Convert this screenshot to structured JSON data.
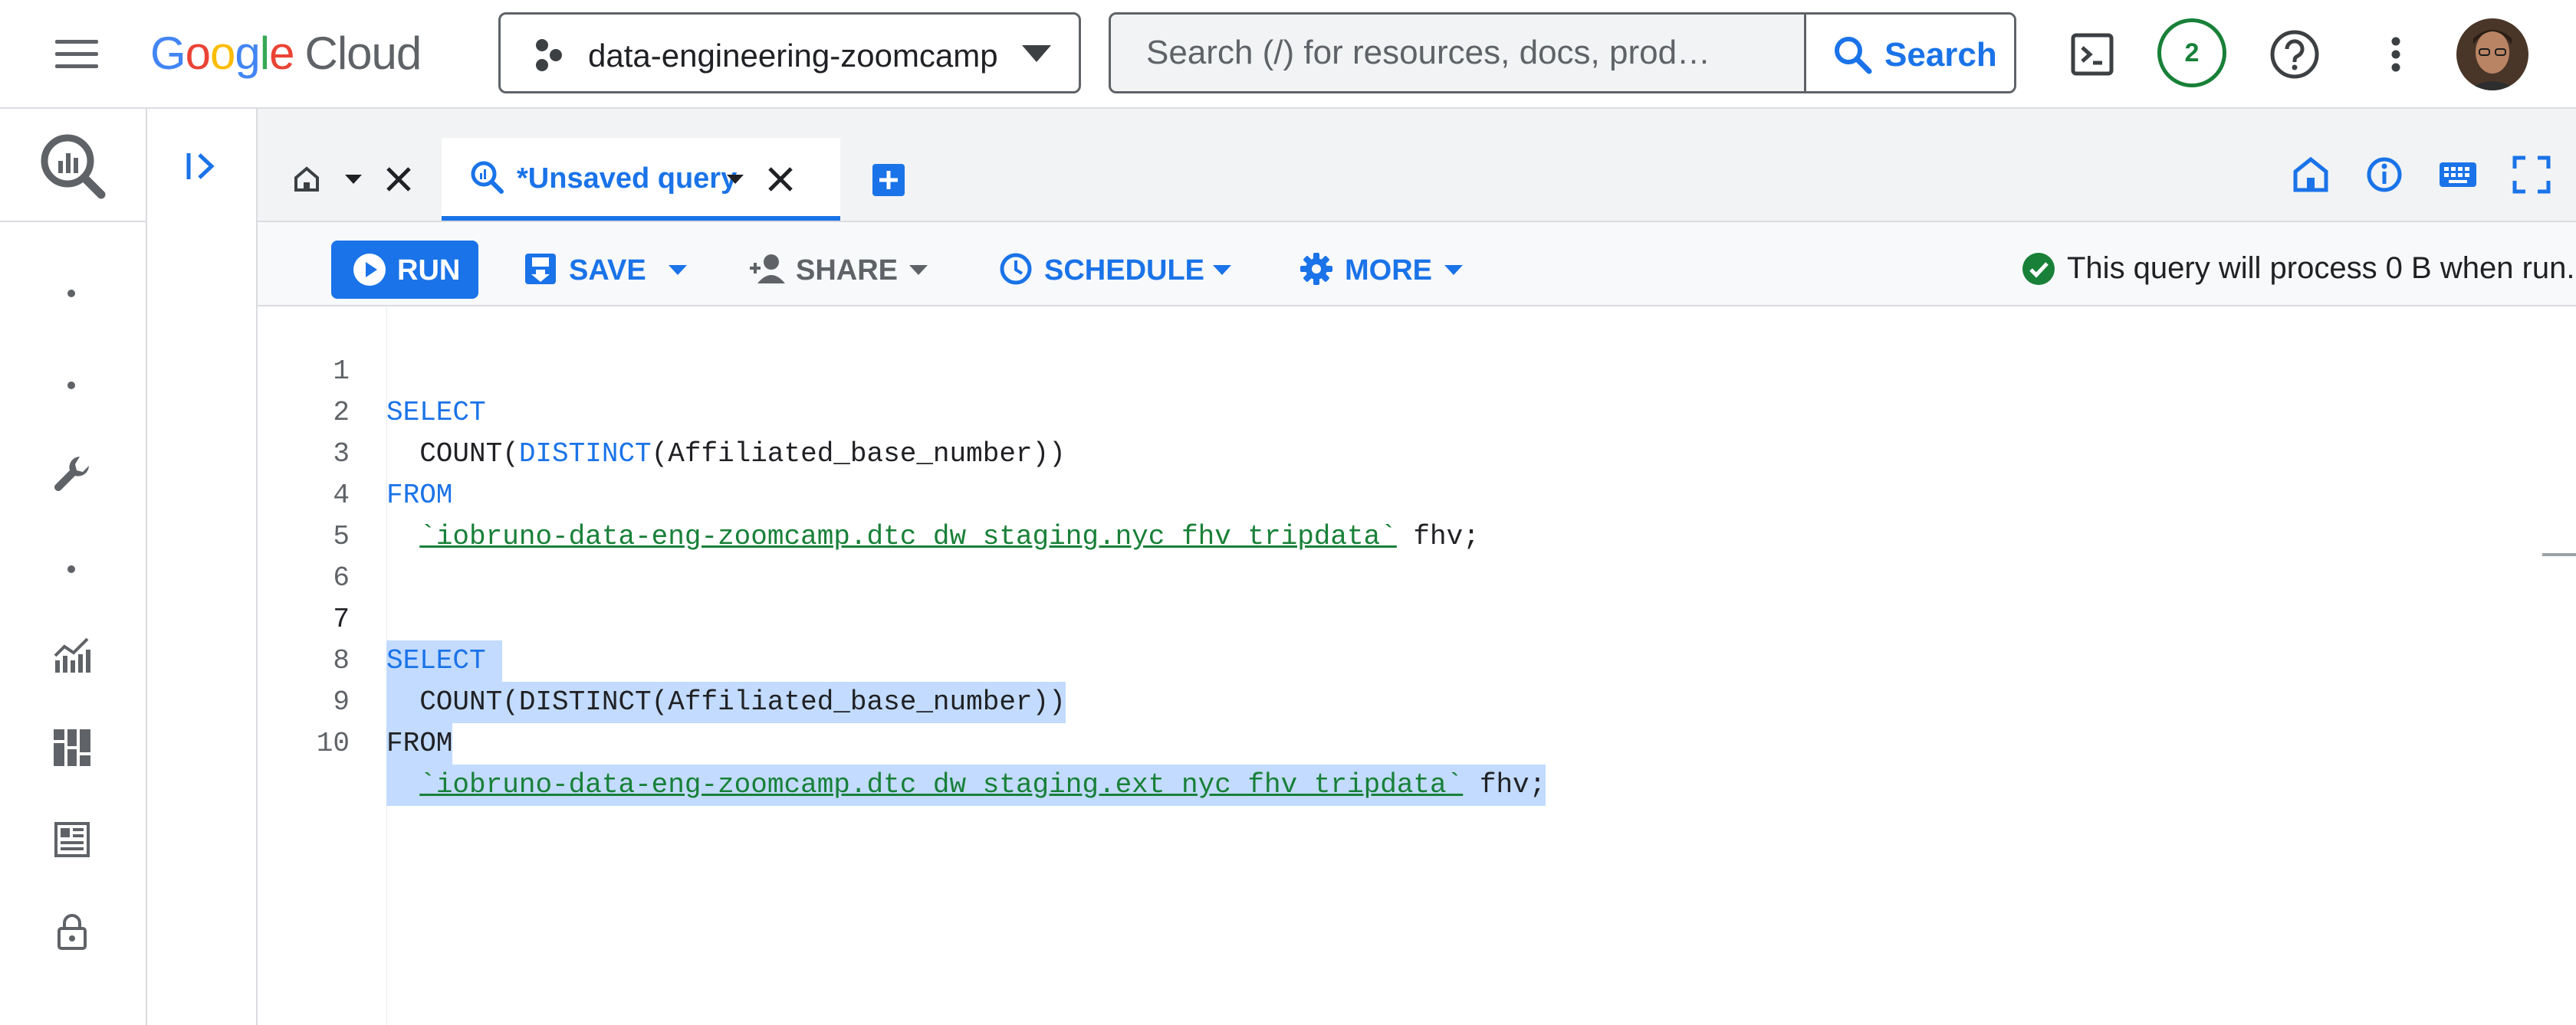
{
  "header": {
    "logo": {
      "google": "Google",
      "cloud": "Cloud"
    },
    "project": "data-engineering-zoomcamp",
    "search_placeholder": "Search (/) for resources, docs, prod…",
    "search_button": "Search",
    "notification_count": "2"
  },
  "tabs": [
    {
      "label": "*Unsaved query",
      "active": true
    }
  ],
  "toolbar": {
    "run": "RUN",
    "save": "SAVE",
    "share": "SHARE",
    "schedule": "SCHEDULE",
    "more": "MORE",
    "status": "This query will process 0 B when run."
  },
  "editor": {
    "line_numbers": [
      "1",
      "2",
      "3",
      "4",
      "5",
      "6",
      "7",
      "8",
      "9",
      "10"
    ],
    "lines": [
      {
        "kw": "SELECT"
      },
      {
        "pre": "  COUNT(",
        "kw": "DISTINCT",
        "post": "(Affiliated_base_number))"
      },
      {
        "kw": "FROM"
      },
      {
        "pre": "  ",
        "tbl": "`iobruno-data-eng-zoomcamp.dtc_dw_staging.nyc_fhv_tripdata`",
        "post": " fhv;"
      },
      {
        "kw": "SELECT"
      },
      {
        "text": "  COUNT(DISTINCT(Affiliated_base_number))"
      },
      {
        "text": "FROM"
      },
      {
        "pre": "  ",
        "tbl": "`iobruno-data-eng-zoomcamp.dtc_dw_staging.ext_nyc_fhv_tripdata`",
        "post": " fhv;"
      }
    ]
  },
  "colors": {
    "accent": "#1a73e8",
    "success": "#188038",
    "selection": "#c2dbff"
  }
}
